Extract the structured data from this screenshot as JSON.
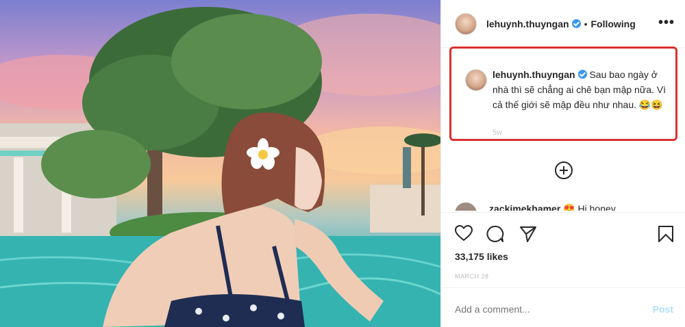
{
  "post": {
    "username": "lehuynh.thuyngan",
    "dot": "•",
    "follow_status": "Following",
    "more_icon": "more-horizontal-icon"
  },
  "caption": {
    "username": "lehuynh.thuyngan",
    "text": "Sau bao ngày ở nhà thì sẽ chẳng ai chê bạn mập nữa. Vì cả thế giới sẽ mập đều như nhau. 😂😆",
    "faded": "5w"
  },
  "comment": {
    "username": "zackimekhamer",
    "text": "😍 Hi honey"
  },
  "stats": {
    "likes": "33,175 likes",
    "date": "MARCH 28"
  },
  "composer": {
    "placeholder": "Add a comment...",
    "post_label": "Post"
  },
  "colors": {
    "highlight": "#d9302b",
    "verified": "#3897f0",
    "post_disabled": "#b2dffc"
  }
}
